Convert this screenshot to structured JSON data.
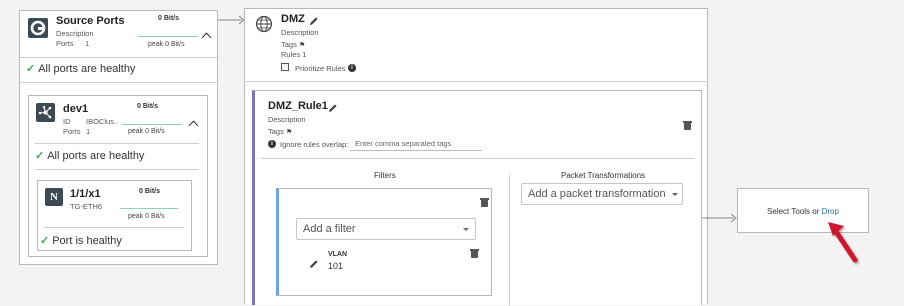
{
  "source_ports": {
    "title": "Source Ports",
    "description_label": "Description",
    "ports_label": "Ports",
    "ports_value": "1",
    "rate": "0 Bit/s",
    "peak": "peak 0 Bit/s",
    "status": "All ports are healthy"
  },
  "device": {
    "name": "dev1",
    "id_label": "ID",
    "id_value": "IBOClus..",
    "ports_label": "Ports",
    "ports_value": "1",
    "rate": "0 Bit/s",
    "peak": "peak 0 Bit/s",
    "status": "All ports are healthy"
  },
  "port": {
    "badge": "N",
    "name": "1/1/x1",
    "subtitle": "TG-ETH6",
    "rate": "0 Bit/s",
    "peak": "peak 0 Bit/s",
    "status": "Port is healthy"
  },
  "dmz": {
    "title": "DMZ",
    "description_label": "Description",
    "tags_label": "Tags",
    "rules_label": "Rules 1",
    "prioritize_label": "Prioritize Rules"
  },
  "rule": {
    "title": "DMZ_Rule1",
    "description_label": "Description",
    "tags_label": "Tags",
    "ignore_overlap_label": "Ignore rules overlap:",
    "tags_input_placeholder": "Enter comma separated tags",
    "filters_header": "Filters",
    "add_filter_placeholder": "Add a filter",
    "filter_item": {
      "name": "VLAN",
      "value": "101"
    },
    "packet_header": "Packet Transformations",
    "add_packet_placeholder": "Add a packet transformation"
  },
  "tools": {
    "prefix": "Select Tools or ",
    "drop_link": "Drop"
  },
  "colors": {
    "accent_purple": "#7b6fc8",
    "accent_blue": "#6aa6e0",
    "healthy_green": "#3aa55b",
    "arrow_red": "#d0192a",
    "link_blue": "#2a6fb5"
  }
}
